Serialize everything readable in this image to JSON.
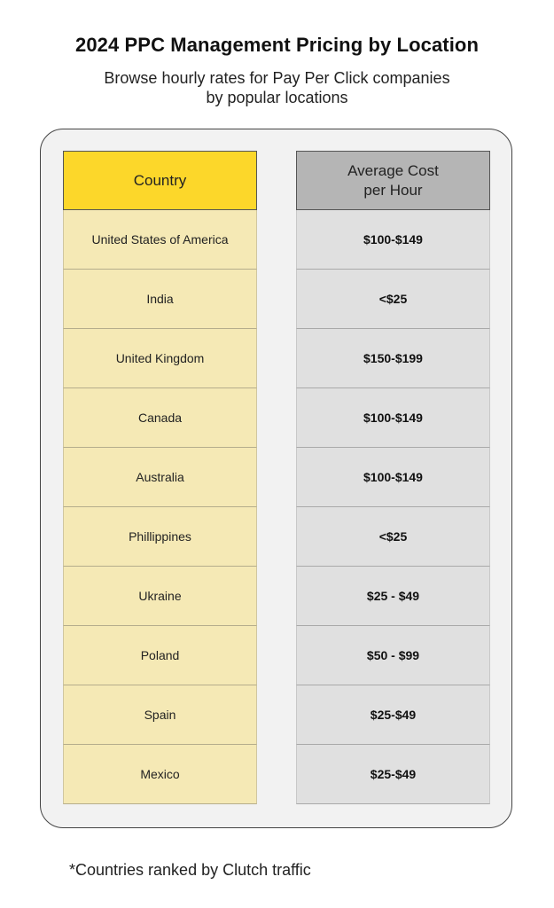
{
  "title": "2024 PPC Management Pricing by Location",
  "subtitle_line1": "Browse hourly rates for Pay Per Click companies",
  "subtitle_line2": "by popular locations",
  "colors": {
    "country_header": "#fcd72a",
    "country_cell": "#f5e9b5",
    "cost_header": "#b5b5b5",
    "cost_cell": "#e0e0e0",
    "panel": "#f2f2f2"
  },
  "chart_data": {
    "type": "table",
    "title": "2024 PPC Management Pricing by Location",
    "columns": [
      "Country",
      "Average Cost per Hour"
    ],
    "header_country": "Country",
    "header_cost_line1": "Average Cost",
    "header_cost_line2": "per Hour",
    "rows": [
      {
        "country": "United States of America",
        "cost": "$100-$149"
      },
      {
        "country": "India",
        "cost": "<$25"
      },
      {
        "country": "United Kingdom",
        "cost": "$150-$199"
      },
      {
        "country": "Canada",
        "cost": "$100-$149"
      },
      {
        "country": "Australia",
        "cost": "$100-$149"
      },
      {
        "country": "Phillippines",
        "cost": "<$25"
      },
      {
        "country": "Ukraine",
        "cost": "$25 - $49"
      },
      {
        "country": "Poland",
        "cost": "$50 - $99"
      },
      {
        "country": "Spain",
        "cost": "$25-$49"
      },
      {
        "country": "Mexico",
        "cost": "$25-$49"
      }
    ]
  },
  "footnote": "*Countries ranked by Clutch traffic"
}
